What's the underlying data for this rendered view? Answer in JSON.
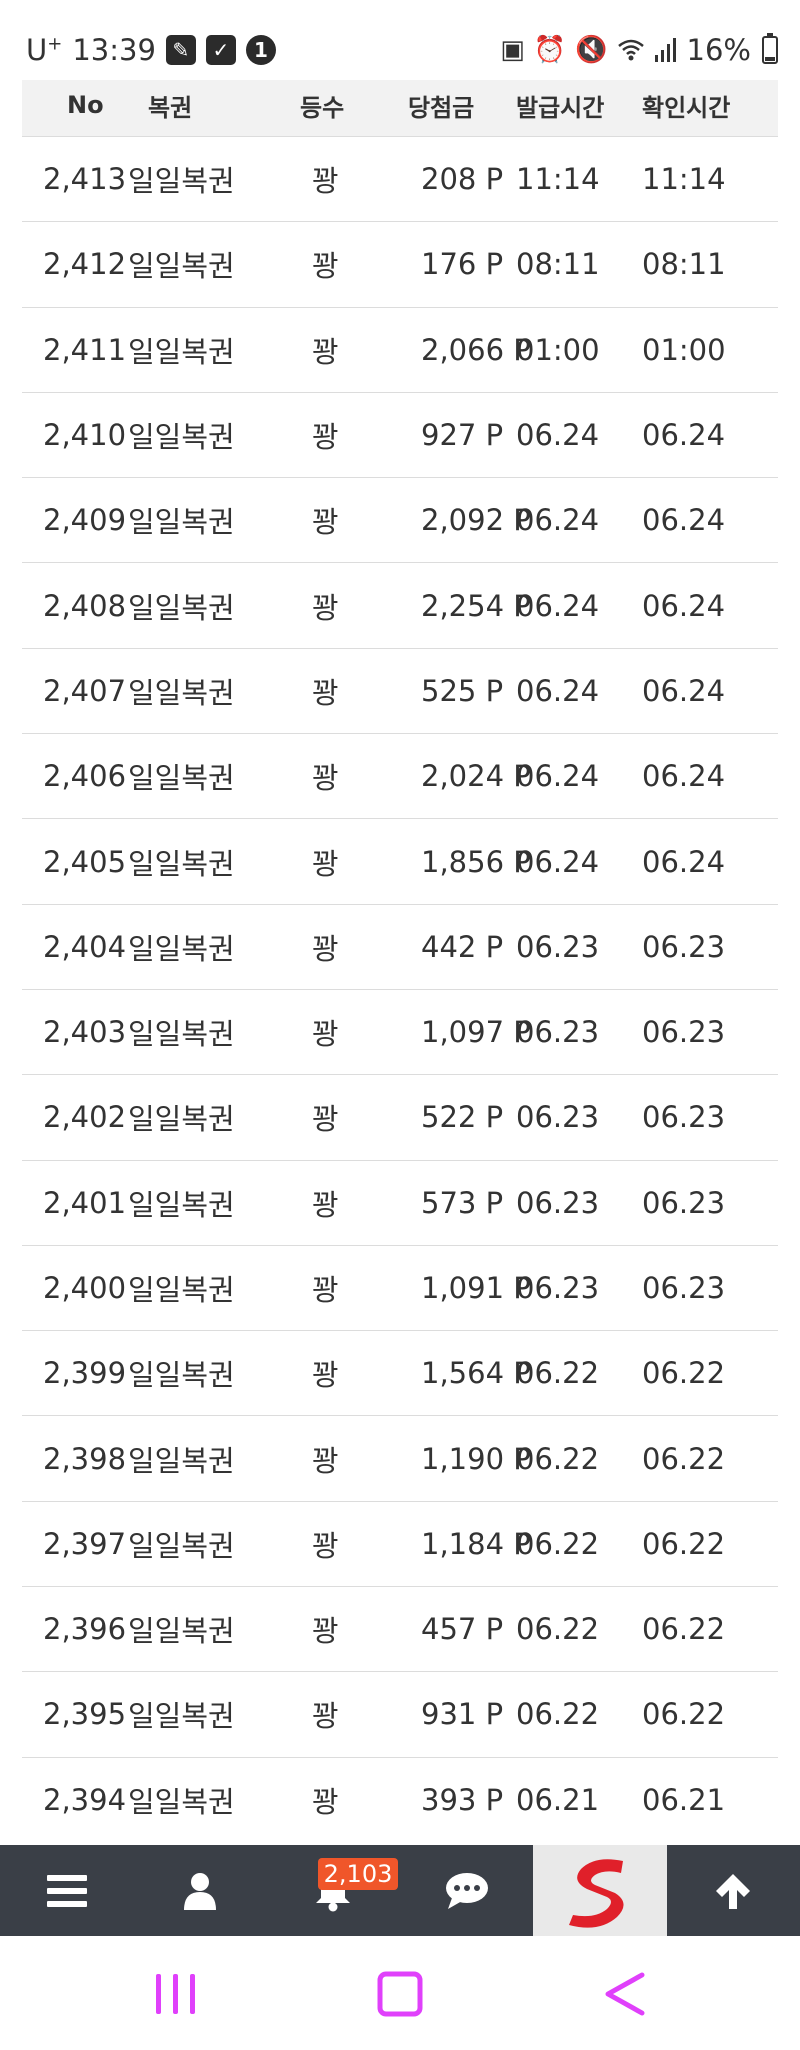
{
  "status_bar": {
    "carrier": "U",
    "carrier_sup": "+",
    "time": "13:39",
    "notif_icons": [
      "pen-app-icon",
      "check-square-icon",
      "one-circle-icon"
    ],
    "right_icons": [
      "lock-battery-icon",
      "alarm-icon",
      "mute-icon",
      "wifi-icon",
      "signal-icon"
    ],
    "battery": "16%"
  },
  "table": {
    "headers": {
      "no": "No",
      "type": "복권",
      "rank": "등수",
      "prize": "당첨금",
      "issued": "발급시간",
      "checked": "확인시간"
    },
    "rows": [
      {
        "no": "2,413",
        "type": "일일복권",
        "rank": "꽝",
        "prize": "208 P",
        "issued": "11:14",
        "checked": "11:14"
      },
      {
        "no": "2,412",
        "type": "일일복권",
        "rank": "꽝",
        "prize": "176 P",
        "issued": "08:11",
        "checked": "08:11"
      },
      {
        "no": "2,411",
        "type": "일일복권",
        "rank": "꽝",
        "prize": "2,066 P",
        "issued": "01:00",
        "checked": "01:00"
      },
      {
        "no": "2,410",
        "type": "일일복권",
        "rank": "꽝",
        "prize": "927 P",
        "issued": "06.24",
        "checked": "06.24"
      },
      {
        "no": "2,409",
        "type": "일일복권",
        "rank": "꽝",
        "prize": "2,092 P",
        "issued": "06.24",
        "checked": "06.24"
      },
      {
        "no": "2,408",
        "type": "일일복권",
        "rank": "꽝",
        "prize": "2,254 P",
        "issued": "06.24",
        "checked": "06.24"
      },
      {
        "no": "2,407",
        "type": "일일복권",
        "rank": "꽝",
        "prize": "525 P",
        "issued": "06.24",
        "checked": "06.24"
      },
      {
        "no": "2,406",
        "type": "일일복권",
        "rank": "꽝",
        "prize": "2,024 P",
        "issued": "06.24",
        "checked": "06.24"
      },
      {
        "no": "2,405",
        "type": "일일복권",
        "rank": "꽝",
        "prize": "1,856 P",
        "issued": "06.24",
        "checked": "06.24"
      },
      {
        "no": "2,404",
        "type": "일일복권",
        "rank": "꽝",
        "prize": "442 P",
        "issued": "06.23",
        "checked": "06.23"
      },
      {
        "no": "2,403",
        "type": "일일복권",
        "rank": "꽝",
        "prize": "1,097 P",
        "issued": "06.23",
        "checked": "06.23"
      },
      {
        "no": "2,402",
        "type": "일일복권",
        "rank": "꽝",
        "prize": "522 P",
        "issued": "06.23",
        "checked": "06.23"
      },
      {
        "no": "2,401",
        "type": "일일복권",
        "rank": "꽝",
        "prize": "573 P",
        "issued": "06.23",
        "checked": "06.23"
      },
      {
        "no": "2,400",
        "type": "일일복권",
        "rank": "꽝",
        "prize": "1,091 P",
        "issued": "06.23",
        "checked": "06.23"
      },
      {
        "no": "2,399",
        "type": "일일복권",
        "rank": "꽝",
        "prize": "1,564 P",
        "issued": "06.22",
        "checked": "06.22"
      },
      {
        "no": "2,398",
        "type": "일일복권",
        "rank": "꽝",
        "prize": "1,190 P",
        "issued": "06.22",
        "checked": "06.22"
      },
      {
        "no": "2,397",
        "type": "일일복권",
        "rank": "꽝",
        "prize": "1,184 P",
        "issued": "06.22",
        "checked": "06.22"
      },
      {
        "no": "2,396",
        "type": "일일복권",
        "rank": "꽝",
        "prize": "457 P",
        "issued": "06.22",
        "checked": "06.22"
      },
      {
        "no": "2,395",
        "type": "일일복권",
        "rank": "꽝",
        "prize": "931 P",
        "issued": "06.22",
        "checked": "06.22"
      },
      {
        "no": "2,394",
        "type": "일일복권",
        "rank": "꽝",
        "prize": "393 P",
        "issued": "06.21",
        "checked": "06.21"
      }
    ]
  },
  "toolbar": {
    "items": [
      "menu-icon",
      "user-icon",
      "bell-icon",
      "chat-icon",
      "site-logo",
      "arrow-up-icon"
    ],
    "notification_count": "2,103",
    "colors": {
      "background": "#3a3f47",
      "badge": "#f0562a",
      "logo_red": "#e0202a"
    }
  },
  "navbar": {
    "buttons": [
      "recent-apps-icon",
      "home-icon",
      "back-icon"
    ],
    "color": "#e040fb"
  }
}
